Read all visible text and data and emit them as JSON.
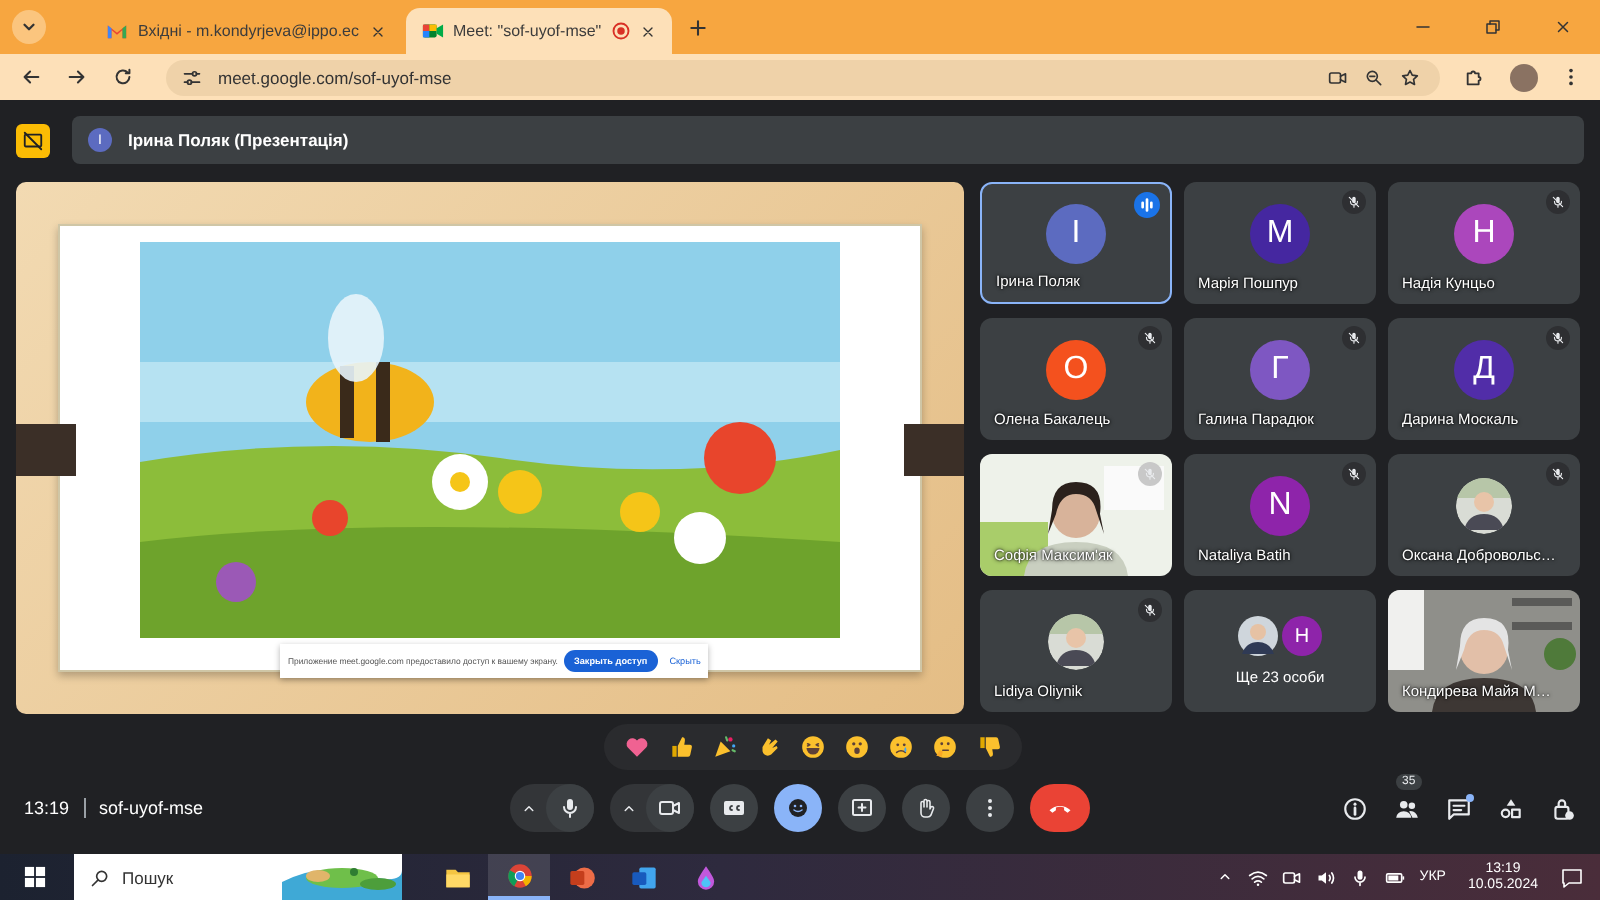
{
  "browser": {
    "tabs": [
      {
        "title": "Вхідні - m.kondyrjeva@ippo.ec",
        "selected": false,
        "recording": false
      },
      {
        "title": "Meet: \"sof-uyof-mse\"",
        "selected": true,
        "recording": true
      }
    ],
    "url": "meet.google.com/sof-uyof-mse"
  },
  "presenter": {
    "initial": "І",
    "color": "#5c6bc0",
    "label": "Ірина Поляк (Презентація)"
  },
  "share_notice": {
    "text": "Приложение meet.google.com предоставило доступ к вашему экрану.",
    "stop_button": "Закрыть доступ",
    "hide_link": "Скрыть"
  },
  "participants": [
    {
      "kind": "initial",
      "name": "Ірина Поляк",
      "initial": "І",
      "color": "#5c6bc0",
      "muted": false,
      "speaking": true
    },
    {
      "kind": "initial",
      "name": "Марія Пошпур",
      "initial": "М",
      "color": "#4527a0",
      "muted": true,
      "speaking": false
    },
    {
      "kind": "initial",
      "name": "Надія Кунцьо",
      "initial": "Н",
      "color": "#ab47bc",
      "muted": true,
      "speaking": false
    },
    {
      "kind": "initial",
      "name": "Олена Бакалець",
      "initial": "О",
      "color": "#f4511e",
      "muted": true,
      "speaking": false
    },
    {
      "kind": "initial",
      "name": "Галина Парадюк",
      "initial": "Г",
      "color": "#7e57c2",
      "muted": true,
      "speaking": false
    },
    {
      "kind": "initial",
      "name": "Дарина Москаль",
      "initial": "Д",
      "color": "#512da8",
      "muted": true,
      "speaking": false
    },
    {
      "kind": "video",
      "name": "Софія Максим'як",
      "muted": true,
      "speaking": false
    },
    {
      "kind": "initial",
      "name": "Nataliya Batih",
      "initial": "N",
      "color": "#8e24aa",
      "muted": true,
      "speaking": false
    },
    {
      "name": "Оксана Добровольс…",
      "muted": true,
      "speaking": false
    },
    {
      "name": "Lidiya Oliynik",
      "muted": true,
      "speaking": false
    },
    {
      "kind": "group",
      "name": "Ще 23 особи",
      "initial": "Н",
      "color": "#8e24aa",
      "muted": false,
      "speaking": false
    },
    {
      "kind": "video",
      "name": "Кондирева Майя М…",
      "muted": false,
      "speaking": false
    }
  ],
  "meeting": {
    "time": "13:19",
    "code": "sof-uyof-mse",
    "participant_count": "35",
    "chat_unread": true
  },
  "taskbar": {
    "search_placeholder": "Пошук",
    "language": "УКР",
    "time": "13:19",
    "date": "10.05.2024"
  }
}
